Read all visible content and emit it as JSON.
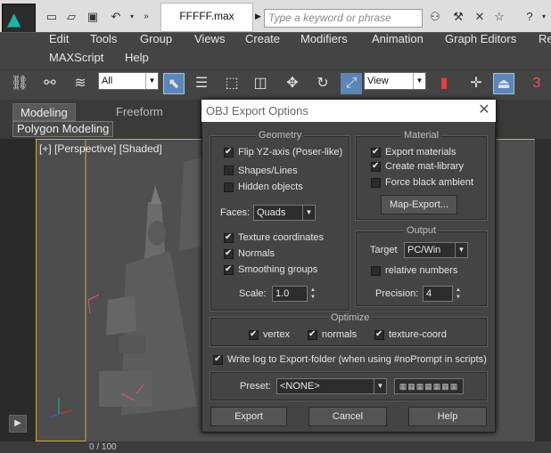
{
  "app": {
    "file_name": "FFFFF.max",
    "search_placeholder": "Type a keyword or phrase"
  },
  "menu": [
    "Edit",
    "Tools",
    "Group",
    "Views",
    "Create",
    "Modifiers",
    "Animation",
    "Graph Editors",
    "Re",
    "MAXScript",
    "Help"
  ],
  "toolbar": {
    "selection_filter": "All",
    "coord_system": "View",
    "number_text": "3"
  },
  "ribbon": {
    "tabs": [
      "Modeling",
      "Freeform"
    ],
    "panel": "Polygon Modeling"
  },
  "viewport": {
    "label": "[+] [Perspective] [Shaded]",
    "frame_counter": "0 / 100"
  },
  "dialog": {
    "title": "OBJ Export Options",
    "geometry": {
      "title": "Geometry",
      "flip_yz": {
        "label": "Flip YZ-axis (Poser-like)",
        "checked": true
      },
      "shapes_lines": {
        "label": "Shapes/Lines",
        "checked": false
      },
      "hidden_objects": {
        "label": "Hidden objects",
        "checked": false
      },
      "faces_label": "Faces:",
      "faces_value": "Quads",
      "texture_coordinates": {
        "label": "Texture coordinates",
        "checked": true
      },
      "normals": {
        "label": "Normals",
        "checked": true
      },
      "smoothing_groups": {
        "label": "Smoothing groups",
        "checked": true
      },
      "scale_label": "Scale:",
      "scale_value": "1.0"
    },
    "material": {
      "title": "Material",
      "export_materials": {
        "label": "Export materials",
        "checked": true
      },
      "create_mat_library": {
        "label": "Create mat-library",
        "checked": true
      },
      "force_black_ambient": {
        "label": "Force black ambient",
        "checked": false
      },
      "map_export_button": "Map-Export..."
    },
    "output": {
      "title": "Output",
      "target_label": "Target",
      "target_value": "PC/Win",
      "relative_numbers": {
        "label": "relative numbers",
        "checked": false
      },
      "precision_label": "Precision:",
      "precision_value": "4"
    },
    "optimize": {
      "title": "Optimize",
      "vertex": {
        "label": "vertex",
        "checked": true
      },
      "normals": {
        "label": "normals",
        "checked": true
      },
      "texture_coord": {
        "label": "texture-coord",
        "checked": true
      }
    },
    "write_log": {
      "label": "Write log to Export-folder (when using #noPrompt in scripts)",
      "checked": true
    },
    "preset_label": "Preset:",
    "preset_value": "<NONE>",
    "buttons": {
      "export": "Export",
      "cancel": "Cancel",
      "help": "Help"
    }
  },
  "colors": {
    "viewport_border": "#cfae3c",
    "dialog_bg": "#444444",
    "accent_teal": "#1cb3a6"
  }
}
